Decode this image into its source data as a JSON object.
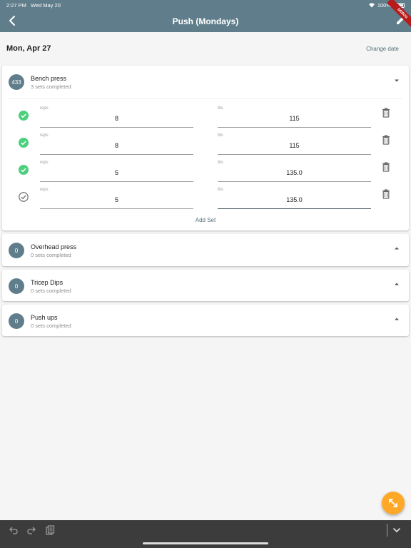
{
  "status_bar": {
    "time": "2:27 PM",
    "date": "Wed May 20",
    "battery": "100%"
  },
  "app_bar": {
    "title": "Push (Mondays)",
    "debug_label": "DEBUG"
  },
  "date_row": {
    "date": "Mon, Apr 27",
    "change_label": "Change date"
  },
  "exercises": [
    {
      "count": "433",
      "name": "Bench press",
      "subtitle": "3 sets completed",
      "expanded": true,
      "sets": [
        {
          "reps_label": "reps",
          "reps": "8",
          "lbs_label": "lbs",
          "lbs": "115",
          "done": true
        },
        {
          "reps_label": "reps",
          "reps": "8",
          "lbs_label": "lbs",
          "lbs": "115",
          "done": true
        },
        {
          "reps_label": "reps",
          "reps": "5",
          "lbs_label": "lbs",
          "lbs": "135.0",
          "done": true
        },
        {
          "reps_label": "reps",
          "reps": "5",
          "lbs_label": "lbs",
          "lbs": "135.0",
          "done": false
        }
      ],
      "add_set_label": "Add Set"
    },
    {
      "count": "0",
      "name": "Overhead press",
      "subtitle": "0 sets completed",
      "expanded": false
    },
    {
      "count": "0",
      "name": "Tricep Dips",
      "subtitle": "0 sets completed",
      "expanded": false
    },
    {
      "count": "0",
      "name": "Push ups",
      "subtitle": "0 sets completed",
      "expanded": false
    }
  ],
  "colors": {
    "primary": "#607d8b",
    "accent": "#ffa726",
    "check_done": "#4cd07d",
    "toolbar": "#3c3c3c"
  },
  "icons": [
    "back-arrow-icon",
    "edit-pencil-icon",
    "chevron-down-icon",
    "chevron-up-icon",
    "check-circle-icon",
    "trash-icon",
    "expand-icon",
    "undo-icon",
    "redo-icon",
    "clipboard-icon"
  ]
}
